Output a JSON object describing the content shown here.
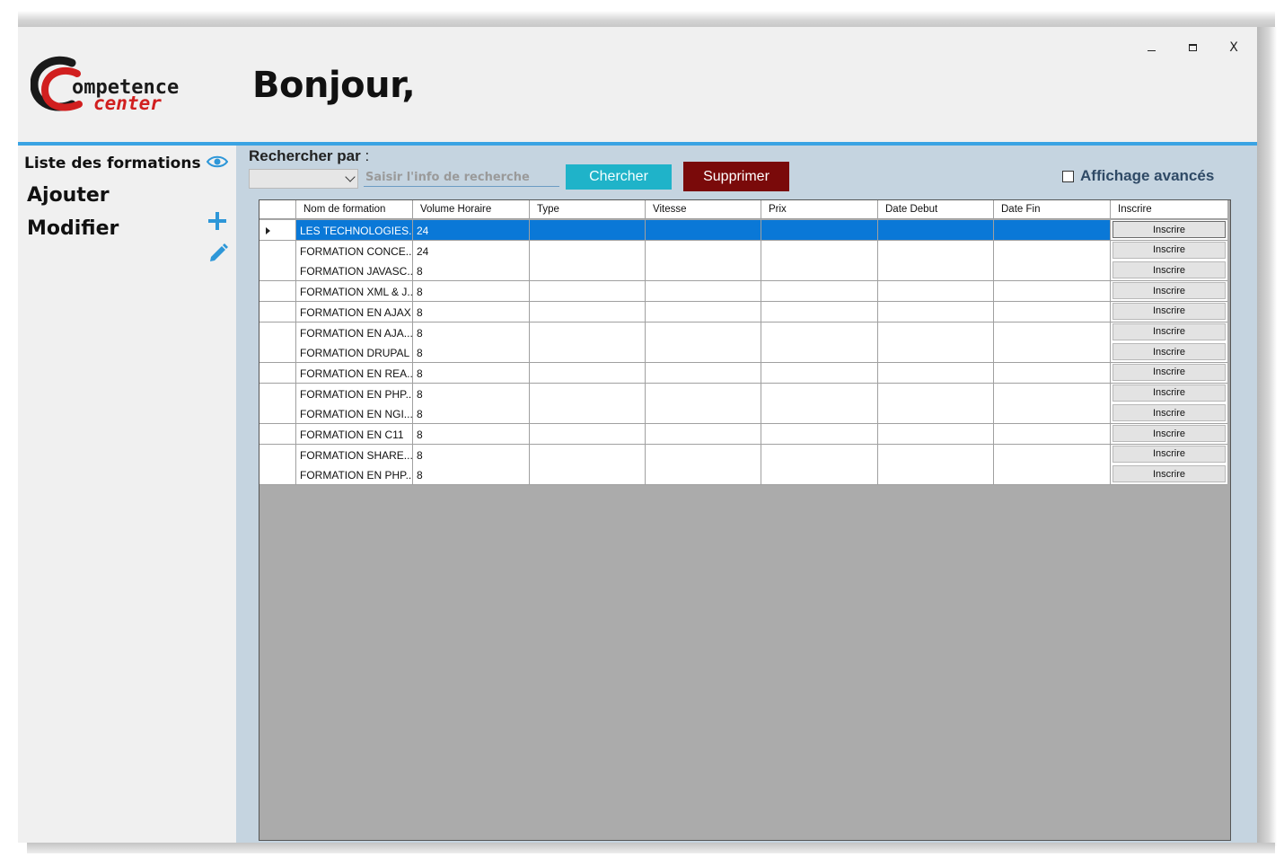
{
  "window": {
    "controls": {
      "minimize": "–",
      "maximize": "□",
      "close": "X"
    }
  },
  "header": {
    "logo": {
      "line1": "ompetence",
      "line2": "center",
      "brand_color": "#d11f1f"
    },
    "greeting": "Bonjour,"
  },
  "sidebar": {
    "items": [
      {
        "label": "Liste des formations",
        "icon": "eye-icon"
      },
      {
        "label": "Ajouter",
        "icon": "plus-icon"
      },
      {
        "label": "Modifier",
        "icon": "pencil-icon"
      }
    ],
    "accent": "#3aa3e3"
  },
  "search": {
    "label": "Rechercher par",
    "colon": ":",
    "selected": "",
    "placeholder": "Saisir l'info de recherche",
    "search_button": "Chercher",
    "delete_button": "Supprimer",
    "advanced_label": "Affichage avancés",
    "advanced_checked": false
  },
  "table": {
    "columns": [
      "Nom de formation",
      "Volume Horaire",
      "Type",
      "Vitesse",
      "Prix",
      "Date Debut",
      "Date Fin",
      "Inscrire"
    ],
    "selected_row": 0,
    "button_label": "Inscrire",
    "rows": [
      {
        "nom": "LES TECHNOLOGIES...",
        "volume": "24",
        "type": "",
        "vitesse": "",
        "prix": "",
        "debut": "",
        "fin": ""
      },
      {
        "nom": "FORMATION CONCE...",
        "volume": "24",
        "type": "",
        "vitesse": "",
        "prix": "",
        "debut": "",
        "fin": ""
      },
      {
        "nom": "FORMATION JAVASC...",
        "volume": "8",
        "type": "",
        "vitesse": "",
        "prix": "",
        "debut": "",
        "fin": ""
      },
      {
        "nom": "FORMATION XML & J...",
        "volume": "8",
        "type": "",
        "vitesse": "",
        "prix": "",
        "debut": "",
        "fin": ""
      },
      {
        "nom": "FORMATION EN AJAX",
        "volume": "8",
        "type": "",
        "vitesse": "",
        "prix": "",
        "debut": "",
        "fin": ""
      },
      {
        "nom": "FORMATION EN AJA...",
        "volume": "8",
        "type": "",
        "vitesse": "",
        "prix": "",
        "debut": "",
        "fin": ""
      },
      {
        "nom": "FORMATION DRUPAL",
        "volume": "8",
        "type": "",
        "vitesse": "",
        "prix": "",
        "debut": "",
        "fin": ""
      },
      {
        "nom": "FORMATION EN REA...",
        "volume": "8",
        "type": "",
        "vitesse": "",
        "prix": "",
        "debut": "",
        "fin": ""
      },
      {
        "nom": "FORMATION EN PHP...",
        "volume": "8",
        "type": "",
        "vitesse": "",
        "prix": "",
        "debut": "",
        "fin": ""
      },
      {
        "nom": "FORMATION EN NGI...",
        "volume": "8",
        "type": "",
        "vitesse": "",
        "prix": "",
        "debut": "",
        "fin": ""
      },
      {
        "nom": "FORMATION EN C11",
        "volume": "8",
        "type": "",
        "vitesse": "",
        "prix": "",
        "debut": "",
        "fin": ""
      },
      {
        "nom": "FORMATION SHARE...",
        "volume": "8",
        "type": "",
        "vitesse": "",
        "prix": "",
        "debut": "",
        "fin": ""
      },
      {
        "nom": "FORMATION EN PHP...",
        "volume": "8",
        "type": "",
        "vitesse": "",
        "prix": "",
        "debut": "",
        "fin": ""
      }
    ]
  },
  "colors": {
    "panel_bg": "#c5d4e0",
    "search_button": "#1fb3c9",
    "delete_button": "#7a0a0a",
    "selection": "#0a78d7",
    "grid_empty": "#ababab"
  }
}
